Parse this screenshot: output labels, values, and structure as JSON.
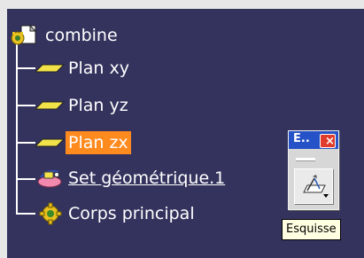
{
  "tree": {
    "root_label": "combine",
    "items": [
      {
        "label": "Plan xy",
        "icon": "plane-icon",
        "selected": false
      },
      {
        "label": "Plan yz",
        "icon": "plane-icon",
        "selected": false
      },
      {
        "label": "Plan zx",
        "icon": "plane-icon",
        "selected": true
      },
      {
        "label": "Set géométrique.1",
        "icon": "geometrical-set-icon",
        "selected": false
      },
      {
        "label": "Corps principal",
        "icon": "part-body-icon",
        "selected": false
      }
    ]
  },
  "toolbar": {
    "title": "E..",
    "close_label": "×",
    "button_icon": "sketch-icon"
  },
  "tooltip": {
    "text": "Esquisse"
  },
  "colors": {
    "background": "#34335e",
    "selection": "#ff8a1e",
    "toolbar_title": "#2652c8"
  }
}
